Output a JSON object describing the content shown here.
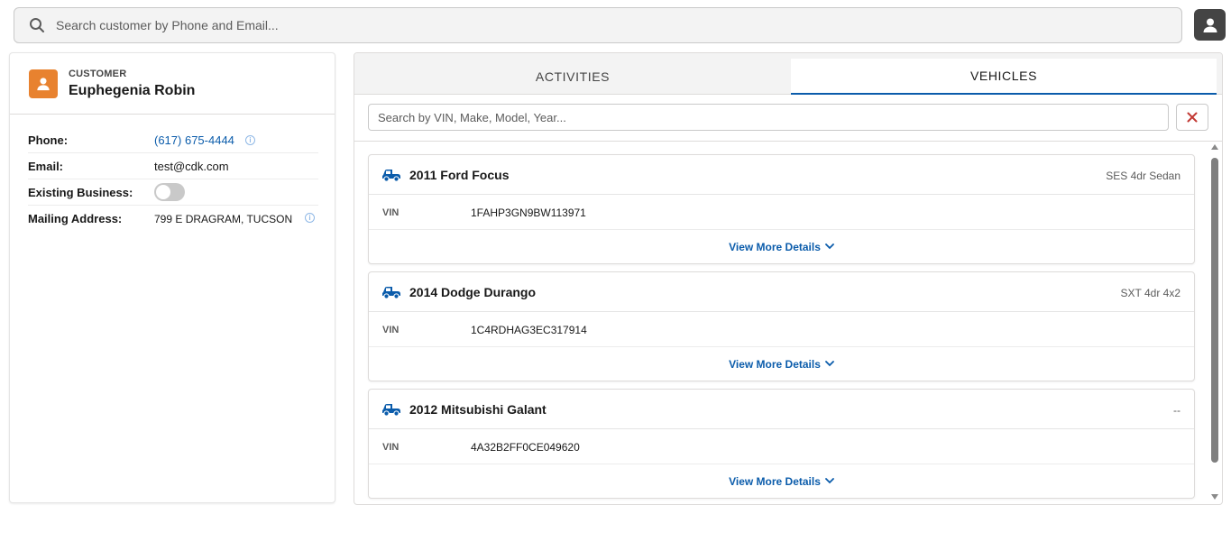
{
  "search": {
    "placeholder": "Search customer by Phone and Email..."
  },
  "customer": {
    "section_label": "CUSTOMER",
    "name": "Euphegenia Robin",
    "details": [
      {
        "label": "Phone:",
        "value": "(617) 675-4444"
      },
      {
        "label": "Email:",
        "value": "test@cdk.com"
      },
      {
        "label": "Existing Business:",
        "value_toggle": false
      },
      {
        "label": "Mailing Address:",
        "value": "799 E DRAGRAM, TUCSON"
      }
    ]
  },
  "tabs": [
    {
      "label": "ACTIVITIES",
      "active": false
    },
    {
      "label": "VEHICLES",
      "active": true
    }
  ],
  "vehicle_search": {
    "placeholder": "Search by VIN, Make, Model, Year..."
  },
  "vehicles": [
    {
      "title": "2011 Ford Focus",
      "trim": "SES 4dr Sedan",
      "vin_label": "VIN",
      "vin": "1FAHP3GN9BW113971",
      "more": "View More Details"
    },
    {
      "title": "2014 Dodge Durango",
      "trim": "SXT 4dr 4x2",
      "vin_label": "VIN",
      "vin": "1C4RDHAG3EC317914",
      "more": "View More Details"
    },
    {
      "title": "2012 Mitsubishi Galant",
      "trim": "--",
      "vin_label": "VIN",
      "vin": "4A32B2FF0CE049620",
      "more": "View More Details"
    }
  ],
  "colors": {
    "accent": "#0b5cab",
    "customer_icon": "#e8822f",
    "clear": "#c23934"
  },
  "icons": [
    "search-icon",
    "user-icon",
    "info-icon",
    "close-icon",
    "car-icon",
    "chevron-down-icon"
  ]
}
